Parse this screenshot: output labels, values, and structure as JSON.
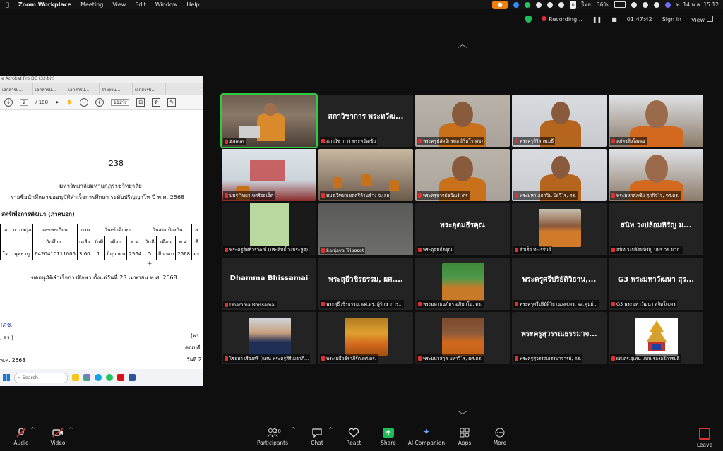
{
  "menubar": {
    "apple": "",
    "app": "Zoom Workplace",
    "items": [
      "Meeting",
      "View",
      "Edit",
      "Window",
      "Help"
    ],
    "battery": "36%",
    "lang": "ไทย",
    "lang_badge": "ก",
    "datetime": "พ. 14 พ.ค.  15:12"
  },
  "zoom_top": {
    "recording": "Recording...",
    "timer": "01:47:42",
    "sign_in": "Sign in",
    "view": "View"
  },
  "shared_screen": {
    "window_title": "e Acrobat Pro DC (32-bit)",
    "tabs": [
      "เอกสารป...",
      "เอกสารป...",
      "เอกสารป...",
      "รายงาน...",
      "เอกสารป..."
    ],
    "page_current": "2",
    "page_total": "/ 100",
    "zoom": "112%",
    "doc": {
      "page_number": "238",
      "university": "มหาวิทยาลัยมหามกุฏราชวิทยาลัย",
      "list_title": "รายชื่อนักศึกษาขออนุมัติสำเร็จการศึกษา ระดับปริญญาโท ปี พ.ศ. 2568",
      "program": "สตร์เพื่อการพัฒนา (ภาคนอก)",
      "headers_row1": [
        "",
        "นามสกุล",
        "เลขทะเบียน",
        "เกรด",
        "วันเข้าศึกษา",
        "วันสอบป้องกัน",
        "ส"
      ],
      "headers_row2": [
        "ล",
        "",
        "นักศึกษา",
        "เฉลี่ย",
        "วันที่",
        "เดือน",
        "พ.ศ.",
        "วันที่",
        "เดือน",
        "พ.ศ.",
        "ที"
      ],
      "row": [
        "โฆ",
        "พุทธาบู",
        "6420410111005",
        "3.60",
        "1",
        "มิถุนายน",
        "2564",
        "5",
        "มีนาคม",
        "2568",
        "มะ"
      ],
      "approval": "ขออนุมัติสำเร็จการศึกษา ตั้งแต่วันที่ 23 เมษายน พ.ศ. 2568",
      "sig1": "เดช.",
      "sig2": ", ดร.)",
      "year": "พ.ศ. 2568",
      "right1": "(พร",
      "right2": "คณบดี",
      "right3": "วันที่ 2"
    },
    "taskbar_search": "Search"
  },
  "tiles": [
    {
      "name": "Admin",
      "type": "video-room",
      "big": ""
    },
    {
      "name": "สภาวิชาการ พระทวัฒชัย",
      "type": "text",
      "big": "สภาวิชาการ พระทวัฒ..."
    },
    {
      "name": "พระครูปลัดจักรพล สิริธโร(ศข)",
      "type": "video-monk",
      "big": ""
    },
    {
      "name": "พระครูสิริสารเมธี",
      "type": "video-monk2",
      "big": ""
    },
    {
      "name": "สุภัทรสิงโสภณ",
      "type": "video-monk3",
      "big": ""
    },
    {
      "name": "มมร วิทยาเขตร้อยเอ็ด",
      "type": "video-hall",
      "big": ""
    },
    {
      "name": "มมร.วิทยาเขตศรีล้านช้าง จ.เลย",
      "type": "video-hall2",
      "big": ""
    },
    {
      "name": "พระครูบวรธัชวัฒร์, ดร",
      "type": "video-monk",
      "big": ""
    },
    {
      "name": "พระมหาเอกกวิน ปิยวีโร, ดร.",
      "type": "video-monk2",
      "big": ""
    },
    {
      "name": "พระมหาศุภชัย สุภกิจโจ, รศ.ดร.",
      "type": "video-monk3",
      "big": ""
    },
    {
      "name": "พระครูสิทธิวรวัฒน์ (ประสิทธิ์ วงประสูต)",
      "type": "video-green",
      "big": ""
    },
    {
      "name": "Sanjaya Triposot",
      "type": "video-dark",
      "big": ""
    },
    {
      "name": "พระอุดมธีรคุณ",
      "type": "text",
      "big": "พระอุดมธีรคุณ"
    },
    {
      "name": "สำเร็จ ทะเรรันย์",
      "type": "photo-monk",
      "big": ""
    },
    {
      "name": "สนิท วงปล้อมหิรัญ มมร.วข.มวก.",
      "type": "text",
      "big": "สนิท  วงปล้อมหิรัญ ม..."
    },
    {
      "name": "Dhamma Bhissamai",
      "type": "text",
      "big": "Dhamma Bhissamai"
    },
    {
      "name": "พระสุธีวชิรธรรม, ผศ.ดร. ผู้รักษาการ...",
      "type": "text",
      "big": "พระสุธีวชิรธรรม, ผศ...."
    },
    {
      "name": "พระมหาธนภัทร อภิชาโน, ดร.",
      "type": "photo-tree",
      "big": ""
    },
    {
      "name": "พระครูศรีปริยัติวิธาน,ผศ.ดร. ผอ.ศูนย์...",
      "type": "text",
      "big": "พระครูศรีปริยัติวิธาน,..."
    },
    {
      "name": "G3 พระมหาวัฒนา สุจิตฺโต,ดร",
      "type": "text",
      "big": "G3 พระมหาวัฒนา สุร..."
    },
    {
      "name": "ไชยยา เรืองศรี (แทน พระครูสิริเมธาภิ...",
      "type": "photo-suit",
      "big": ""
    },
    {
      "name": "พระเมธีวชิราภิรัต,ผศ.ดร.",
      "type": "photo-gold",
      "big": ""
    },
    {
      "name": "พระมหาสกุล มหาวีโร, ผศ.ดร.",
      "type": "photo-book",
      "big": ""
    },
    {
      "name": "พระครูสุวรรณธรรมาจารย์, ดร.",
      "type": "text",
      "big": "พระครูสุวรรณธรรมาจ..."
    },
    {
      "name": "ผศ.ดร.อุเทน แทน รองอธิการบดี",
      "type": "photo-logo",
      "big": ""
    }
  ],
  "bottom_bar": {
    "audio": "Audio",
    "video": "Video",
    "participants": "Participants",
    "participants_count": "30",
    "chat": "Chat",
    "react": "React",
    "share": "Share",
    "ai": "AI Companion",
    "apps": "Apps",
    "more": "More",
    "leave": "Leave"
  }
}
